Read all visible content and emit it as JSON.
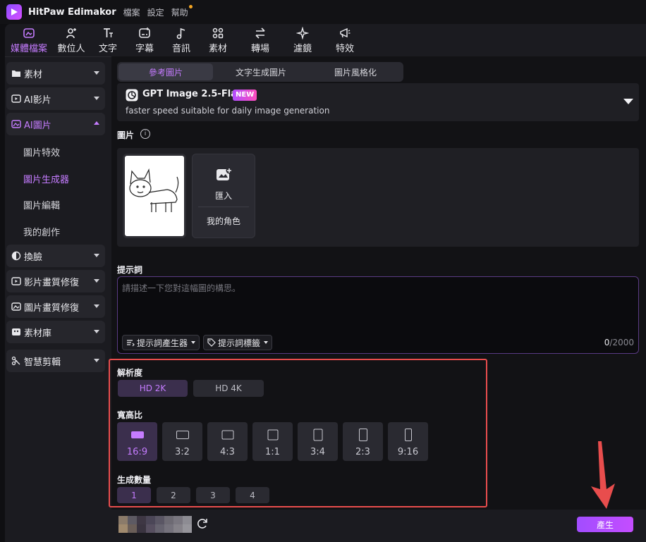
{
  "titlebar": {
    "app_name": "HitPaw Edimakor",
    "menu": [
      "檔案",
      "設定",
      "幫助"
    ]
  },
  "toolbar": {
    "items": [
      {
        "label": "媒體檔案",
        "icon": "media-icon",
        "active": true
      },
      {
        "label": "數位人",
        "icon": "avatar-add-icon"
      },
      {
        "label": "文字",
        "icon": "text-icon"
      },
      {
        "label": "字幕",
        "icon": "subtitle-icon"
      },
      {
        "label": "音訊",
        "icon": "music-note-icon"
      },
      {
        "label": "素材",
        "icon": "elements-grid-icon"
      },
      {
        "label": "轉場",
        "icon": "transition-arrows-icon"
      },
      {
        "label": "濾鏡",
        "icon": "filter-sparkle-icon"
      },
      {
        "label": "特效",
        "icon": "effect-megaphone-icon"
      }
    ]
  },
  "sidebar": {
    "items": [
      {
        "label": "素材",
        "icon": "folder-icon"
      },
      {
        "label": "AI影片",
        "icon": "ai-video-icon"
      },
      {
        "label": "AI圖片",
        "icon": "ai-image-icon",
        "open": true
      },
      {
        "label": "換臉",
        "icon": "face-swap-icon"
      },
      {
        "label": "影片畫質修復",
        "icon": "video-enhance-icon"
      },
      {
        "label": "圖片畫質修復",
        "icon": "image-enhance-icon"
      },
      {
        "label": "素材庫",
        "icon": "library-icon"
      },
      {
        "label": "智慧剪輯",
        "icon": "smart-cut-icon"
      }
    ],
    "sub_items": [
      {
        "label": "圖片特效"
      },
      {
        "label": "圖片生成器",
        "active": true
      },
      {
        "label": "圖片編輯"
      },
      {
        "label": "我的創作"
      }
    ]
  },
  "tabs": [
    {
      "label": "參考圖片",
      "active": true
    },
    {
      "label": "文字生成圖片"
    },
    {
      "label": "圖片風格化"
    }
  ],
  "model": {
    "name": "GPT Image 2.5-Flare",
    "badge": "NEW",
    "description": "faster speed suitable for daily image generation"
  },
  "image_section": {
    "label": "圖片",
    "import_label": "匯入",
    "my_character_label": "我的角色"
  },
  "prompt": {
    "label": "提示詞",
    "placeholder": "請描述一下您對這幅圖的構思。",
    "generator_button": "提示詞產生器",
    "tags_button": "提示詞標籤",
    "count_current": "0",
    "count_max": "/2000"
  },
  "resolution": {
    "label": "解析度",
    "options": [
      "HD 2K",
      "HD 4K"
    ],
    "selected": "HD 2K"
  },
  "aspect_ratio": {
    "label": "寬高比",
    "options": [
      "16:9",
      "3:2",
      "4:3",
      "1:1",
      "3:4",
      "2:3",
      "9:16"
    ],
    "selected": "16:9"
  },
  "count": {
    "label": "生成數量",
    "options": [
      "1",
      "2",
      "3",
      "4"
    ],
    "selected": "1"
  },
  "footer": {
    "generate_label": "產生"
  },
  "colors": {
    "accent": "#c57cff",
    "highlight_box": "#e84d4d",
    "arrow": "#e84d4d"
  }
}
